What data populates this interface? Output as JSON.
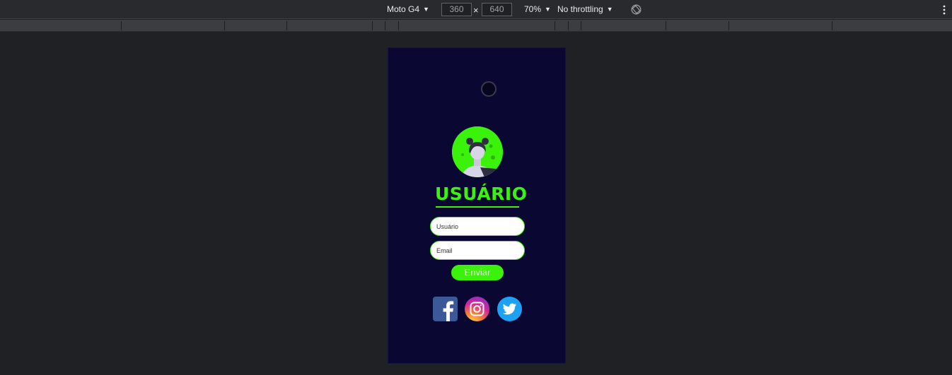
{
  "toolbar": {
    "device": "Moto G4",
    "width": "360",
    "times": "×",
    "height": "640",
    "zoom": "70%",
    "throttling": "No throttling",
    "arrow": "▼"
  },
  "page": {
    "title": "USUÁRIO",
    "user_placeholder": "Usuário",
    "email_placeholder": "Email",
    "submit_label": "Enviar"
  },
  "colors": {
    "accent": "#3bf20a",
    "page_bg": "#0a0833",
    "devtools_bg": "#202124"
  },
  "icons": [
    "camera-notch-icon",
    "rotate-icon",
    "more-vert-icon",
    "facebook-icon",
    "instagram-icon",
    "twitter-icon"
  ]
}
